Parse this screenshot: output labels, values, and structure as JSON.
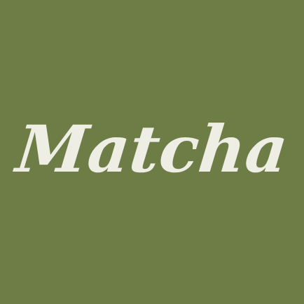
{
  "app_icon": {
    "wordmark": "Matcha",
    "colors": {
      "background": "#6e7d46",
      "wordmark": "#eeeee4"
    }
  }
}
